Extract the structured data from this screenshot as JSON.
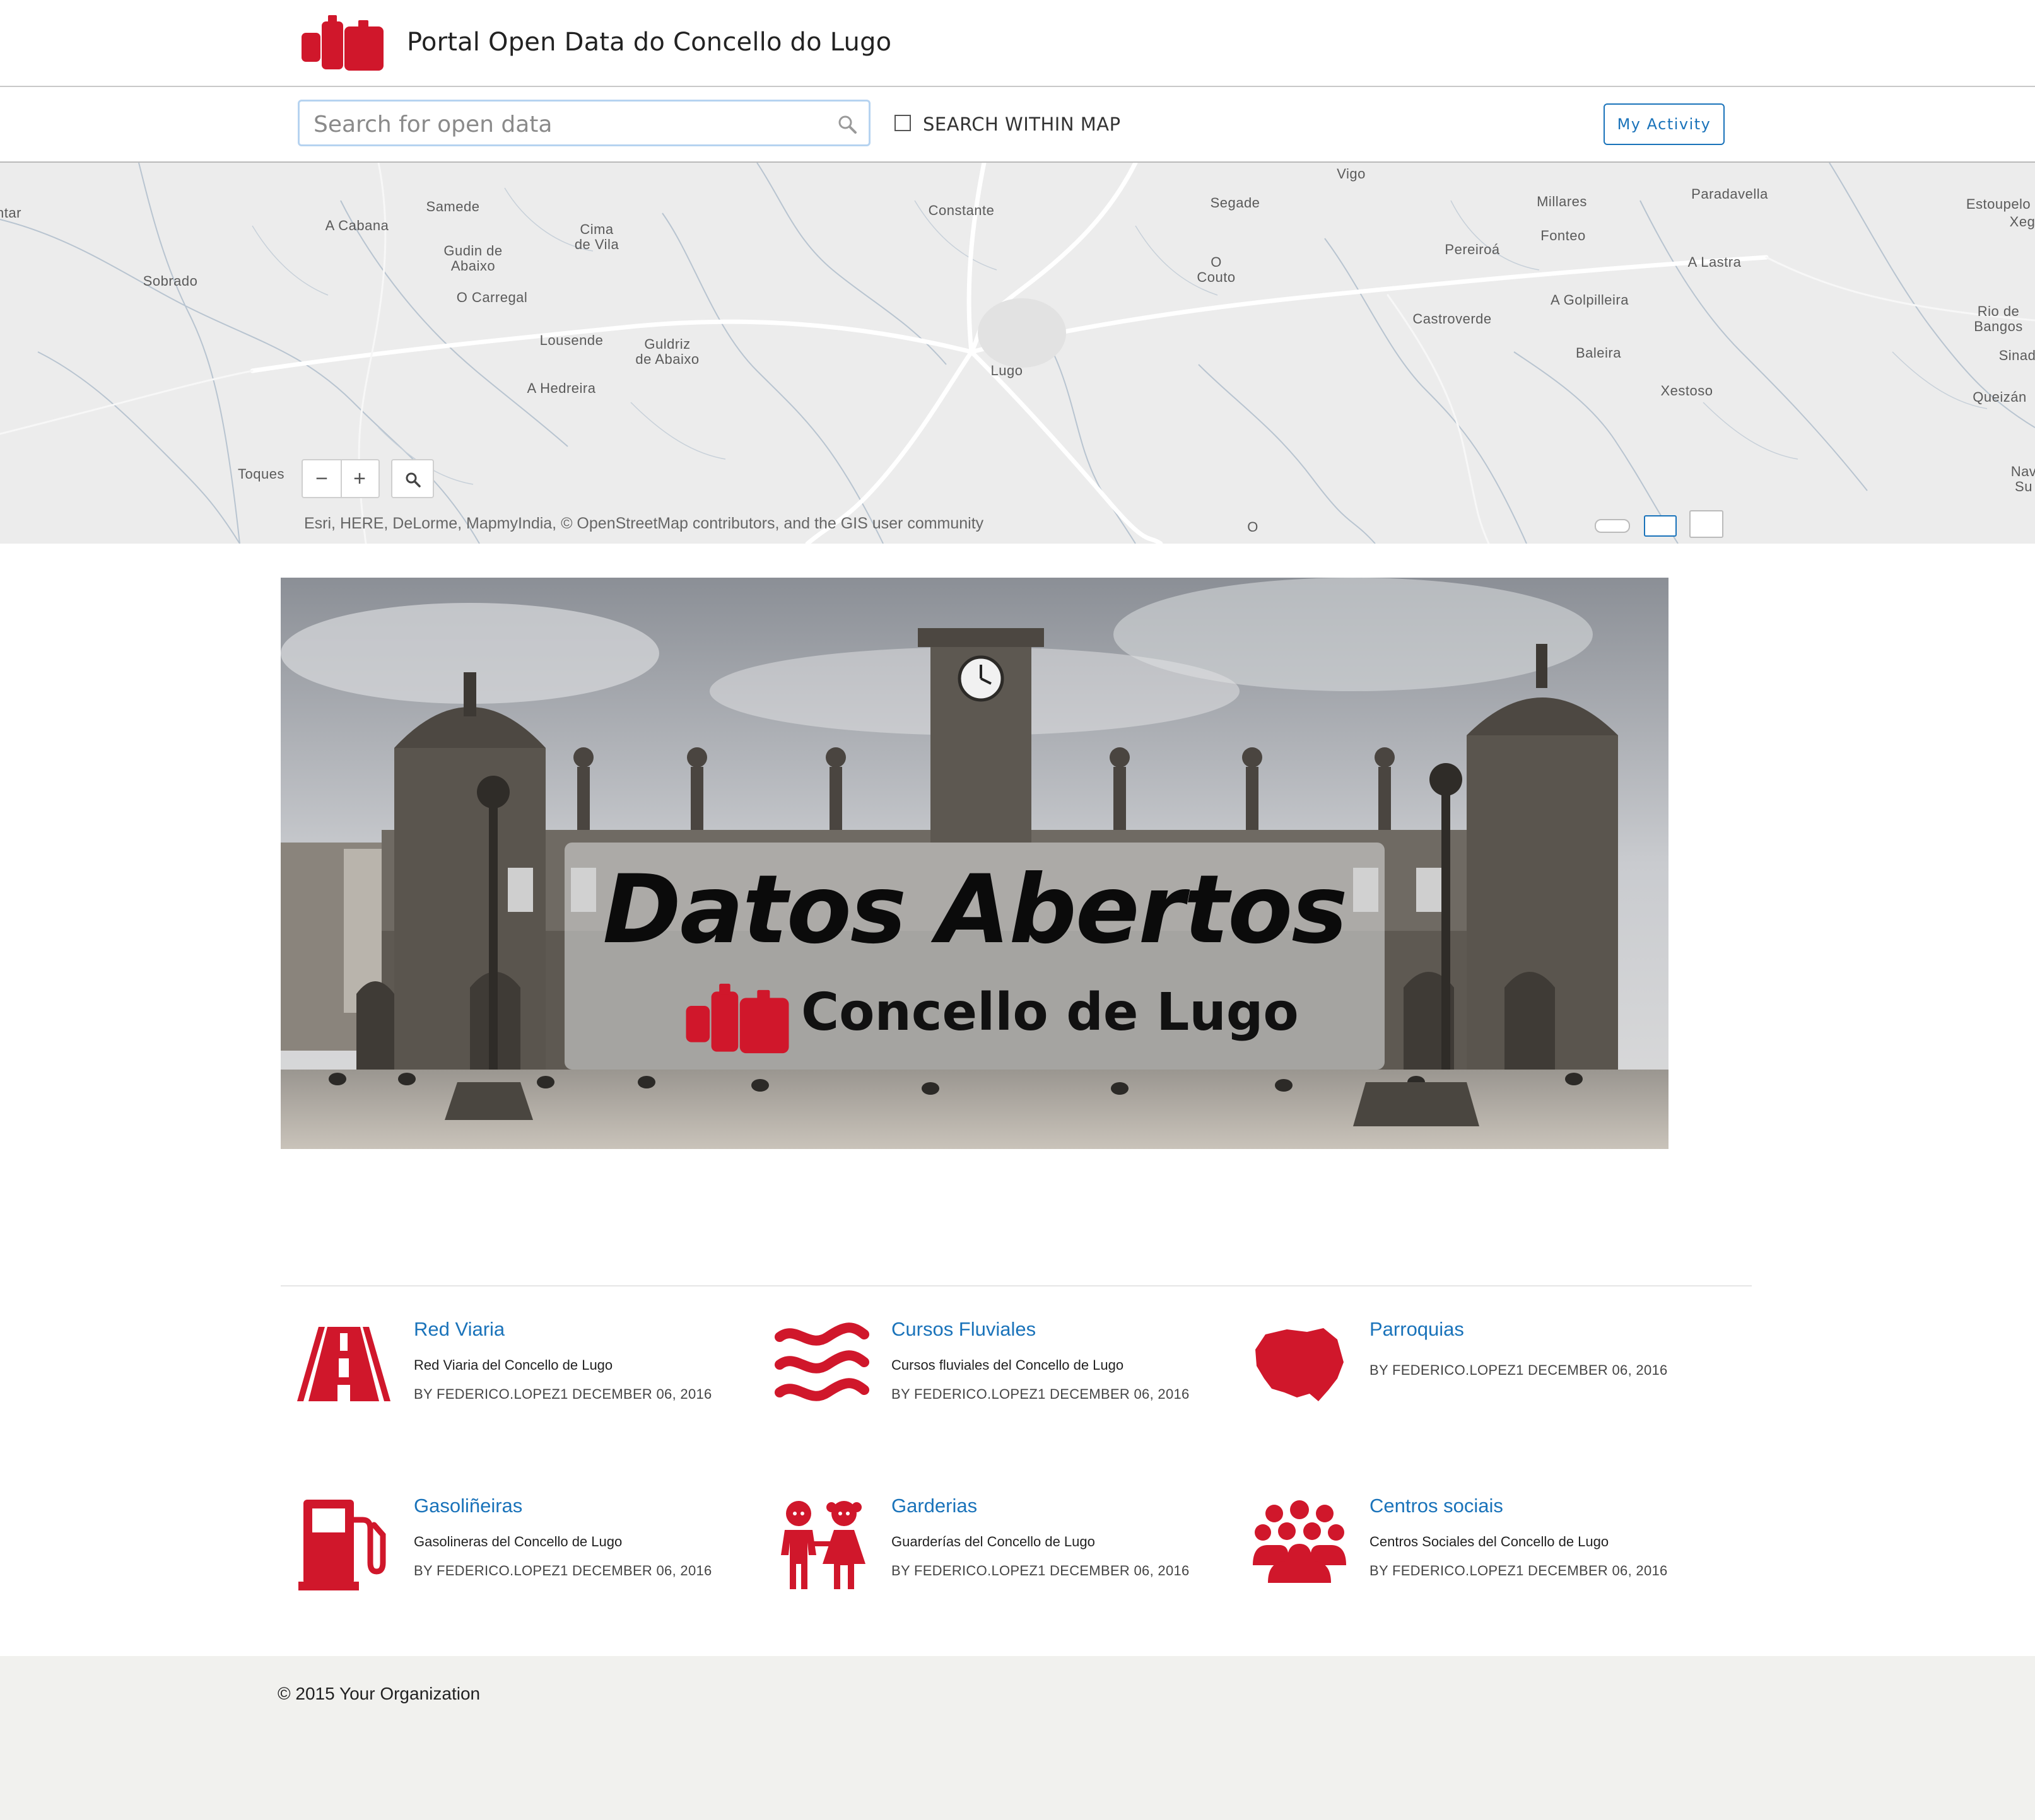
{
  "header": {
    "title": "Portal Open Data do Concello do Lugo",
    "brand_color": "#d0172b"
  },
  "search": {
    "placeholder": "Search for open data",
    "within_map_label": "SEARCH WITHIN MAP",
    "activity_button": "My Activity"
  },
  "map": {
    "places": [
      "ntar",
      "Samede",
      "A Cabana",
      "Cima\nde Vila",
      "Gudin de\nAbaixo",
      "Sobrado",
      "O Carregal",
      "Lousende",
      "Guldriz\nde Abaixo",
      "A Hedreira",
      "Toques",
      "Constante",
      "Vigo",
      "Segade",
      "O\nCouto",
      "Lugo",
      "Millares",
      "Paradavella",
      "Fonteo",
      "Pereiroá",
      "A Lastra",
      "Castroverde",
      "A Golpilleira",
      "Baleira",
      "Xestoso",
      "Estoupelo",
      "Xeg",
      "Rio de\nBangos",
      "Sinad",
      "Queizán",
      "Nav\nSu",
      "O"
    ],
    "zoom_out": "−",
    "zoom_in": "+",
    "attribution": "Esri, HERE, DeLorme, MapmyIndia, © OpenStreetMap contributors, and the GIS user community"
  },
  "banner": {
    "title": "Datos Abertos",
    "subtitle": "Concello de Lugo"
  },
  "datasets": [
    {
      "title": "Red Viaria",
      "description": "Red Viaria del Concello de Lugo",
      "meta": "BY FEDERICO.LOPEZ1 DECEMBER 06, 2016",
      "icon": "road-icon"
    },
    {
      "title": "Cursos Fluviales",
      "description": "Cursos fluviales del Concello de Lugo",
      "meta": "BY FEDERICO.LOPEZ1 DECEMBER 06, 2016",
      "icon": "water-waves-icon"
    },
    {
      "title": "Parroquias",
      "description": "",
      "meta": "BY FEDERICO.LOPEZ1 DECEMBER 06, 2016",
      "icon": "map-region-icon"
    },
    {
      "title": "Gasoliñeiras",
      "description": "Gasolineras del Concello de Lugo",
      "meta": "BY FEDERICO.LOPEZ1 DECEMBER 06, 2016",
      "icon": "fuel-pump-icon"
    },
    {
      "title": "Garderias",
      "description": "Guarderías del Concello de Lugo",
      "meta": "BY FEDERICO.LOPEZ1 DECEMBER 06, 2016",
      "icon": "children-icon"
    },
    {
      "title": "Centros sociais",
      "description": "Centros Sociales del Concello de Lugo",
      "meta": "BY FEDERICO.LOPEZ1 DECEMBER 06, 2016",
      "icon": "people-group-icon"
    }
  ],
  "footer": {
    "copyright": "© 2015 Your Organization"
  },
  "colors": {
    "accent": "#d0172b",
    "link": "#1a73ba",
    "footer_bg": "#f1f1ee"
  }
}
